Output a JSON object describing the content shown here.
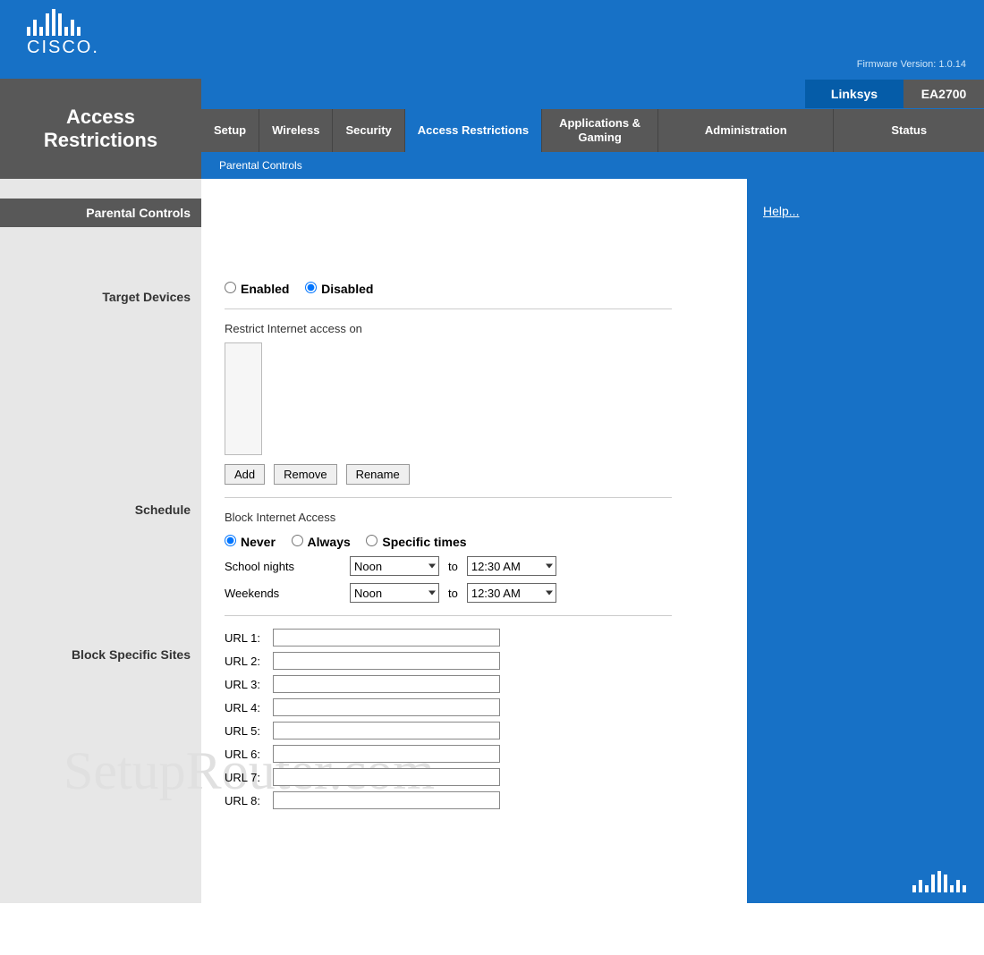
{
  "header": {
    "logo_text": "CISCO.",
    "firmware_label": "Firmware Version: 1.0.14",
    "brand": "Linksys",
    "model": "EA2700"
  },
  "nav": {
    "page_title_1": "Access",
    "page_title_2": "Restrictions",
    "tabs": [
      "Setup",
      "Wireless",
      "Security",
      "Access Restrictions",
      "Applications & Gaming",
      "Administration",
      "Status"
    ],
    "subtab": "Parental Controls"
  },
  "rail": {
    "parental_controls": "Parental Controls",
    "target_devices": "Target Devices",
    "schedule": "Schedule",
    "block_sites": "Block Specific Sites"
  },
  "form": {
    "enabled_label": "Enabled",
    "disabled_label": "Disabled",
    "status_selected": "disabled",
    "restrict_label": "Restrict Internet access on",
    "add_btn": "Add",
    "remove_btn": "Remove",
    "rename_btn": "Rename",
    "block_label": "Block Internet Access",
    "sched_opts": {
      "never": "Never",
      "always": "Always",
      "specific": "Specific times"
    },
    "sched_selected": "never",
    "school_nights": "School nights",
    "weekends": "Weekends",
    "to": "to",
    "school_from": "Noon",
    "school_to": "12:30 AM",
    "weekend_from": "Noon",
    "weekend_to": "12:30 AM",
    "url_prefix": "URL",
    "urls": [
      "",
      "",
      "",
      "",
      "",
      "",
      "",
      ""
    ]
  },
  "sidebar": {
    "help": "Help..."
  },
  "watermark": "SetupRouter.com"
}
